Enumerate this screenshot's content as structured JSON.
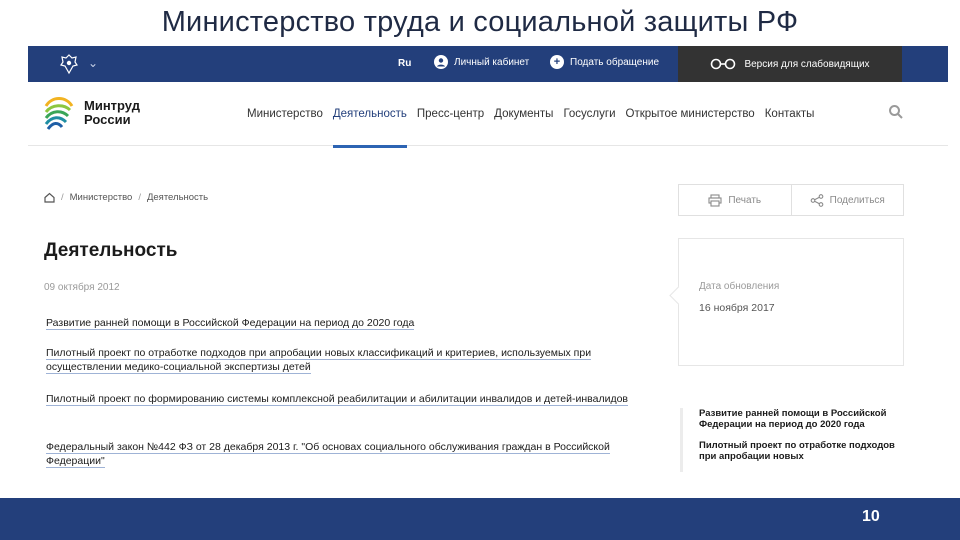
{
  "slide": {
    "title": "Министерство труда и социальной защиты РФ",
    "page_number": "10"
  },
  "topbar": {
    "lang": "Ru",
    "cabinet_label": "Личный кабинет",
    "appeal_label": "Подать обращение",
    "low_vision_label": "Версия для слабовидящих",
    "background": "#233f7b"
  },
  "logo": {
    "line1": "Минтруд",
    "line2": "России"
  },
  "nav": {
    "items": [
      {
        "label": "Министерство"
      },
      {
        "label": "Деятельность"
      },
      {
        "label": "Пресс-центр"
      },
      {
        "label": "Документы"
      },
      {
        "label": "Госуслуги"
      },
      {
        "label": "Открытое министерство"
      },
      {
        "label": "Контакты"
      }
    ],
    "active_index": 1
  },
  "breadcrumb": {
    "items": [
      "Министерство",
      "Деятельность"
    ],
    "separator": "/"
  },
  "tools": {
    "print_label": "Печать",
    "share_label": "Поделиться"
  },
  "page": {
    "heading": "Деятельность",
    "date": "09 октября 2012",
    "links": [
      "Развитие ранней помощи в Российской Федерации на период до 2020 года",
      "Пилотный проект по отработке подходов при апробации новых классификаций и критериев, используемых при осуществлении медико-социальной экспертизы детей",
      "Пилотный проект по формированию системы комплексной реабилитации и абилитации инвалидов и детей-инвалидов",
      "Федеральный закон №442 ФЗ от 28 декабря 2013 г. \"Об основах социального обслуживания граждан в Российской Федерации\""
    ]
  },
  "update": {
    "label": "Дата обновления",
    "date": "16 ноября 2017"
  },
  "side_list": [
    "Развитие ранней помощи в Российской Федерации на период до 2020 года",
    "Пилотный проект по отработке подходов при апробации новых"
  ]
}
